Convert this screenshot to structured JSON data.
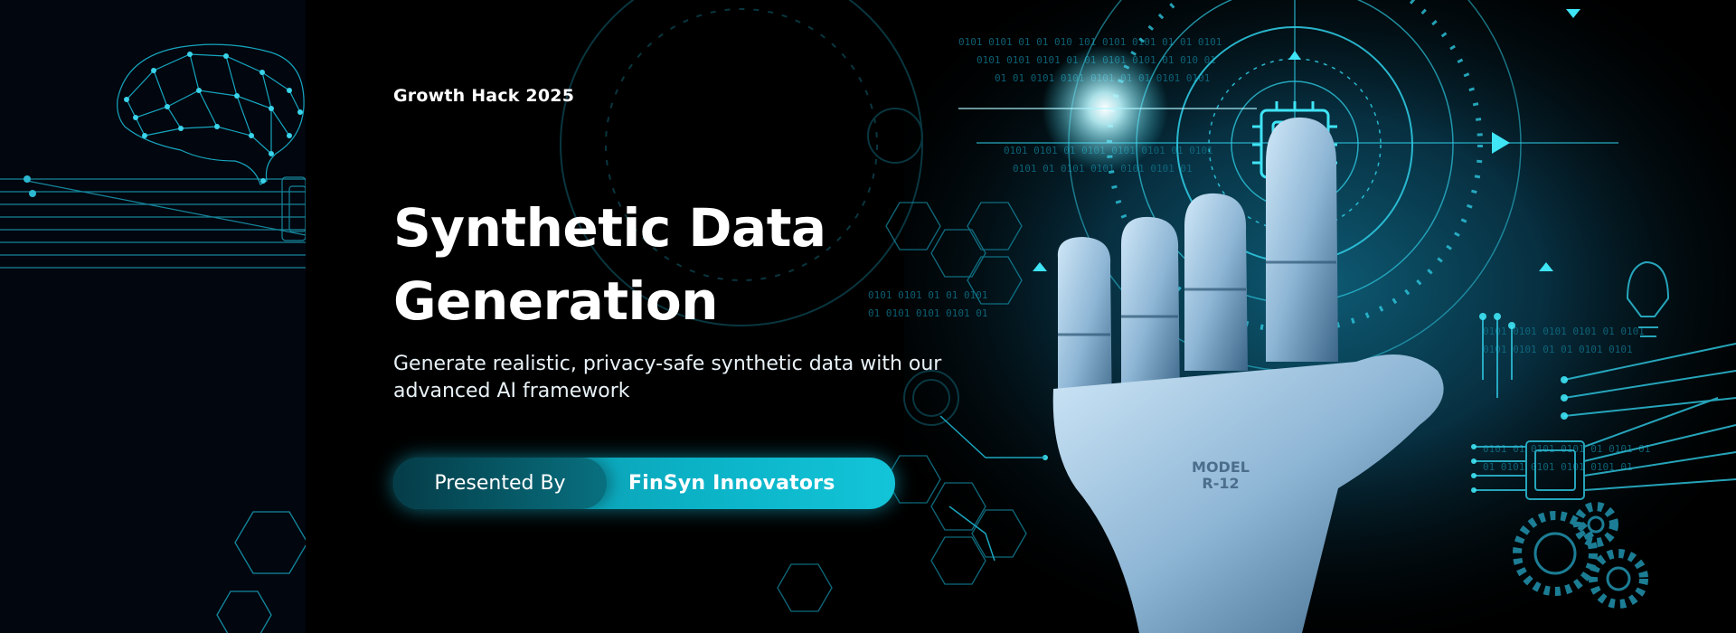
{
  "event": {
    "tag": "Growth Hack 2025"
  },
  "hero": {
    "title_line1": "Synthetic Data",
    "title_line2": "Generation",
    "subtitle": "Generate realistic, privacy-safe synthetic data with our advanced AI framework"
  },
  "presenter": {
    "label": "Presented By",
    "name": "FinSyn Innovators"
  },
  "artwork": {
    "hand_marking_line1": "MODEL",
    "hand_marking_line2": "R-12"
  },
  "colors": {
    "accent": "#19c3d8",
    "background": "#000000",
    "panel": "#02060f",
    "glow": "#3fe4f5"
  }
}
